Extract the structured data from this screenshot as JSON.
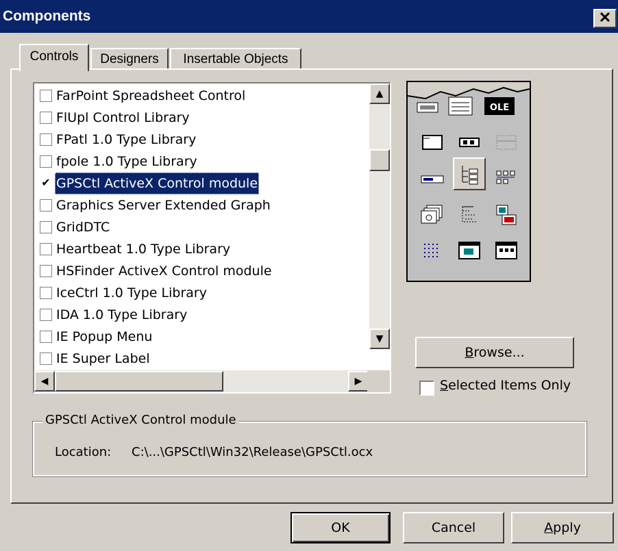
{
  "window": {
    "title": "Components",
    "close_glyph": "✕"
  },
  "tabs": [
    {
      "label": "Controls",
      "active": true
    },
    {
      "label": "Designers",
      "active": false
    },
    {
      "label": "Insertable Objects",
      "active": false
    }
  ],
  "list": {
    "items": [
      {
        "label": "FarPoint Spreadsheet Control",
        "checked": false,
        "selected": false
      },
      {
        "label": "FlUpl Control Library",
        "checked": false,
        "selected": false
      },
      {
        "label": "FPatl 1.0 Type Library",
        "checked": false,
        "selected": false
      },
      {
        "label": "fpole 1.0 Type Library",
        "checked": false,
        "selected": false
      },
      {
        "label": "GPSCtl ActiveX Control module",
        "checked": true,
        "selected": true
      },
      {
        "label": "Graphics Server Extended Graph",
        "checked": false,
        "selected": false
      },
      {
        "label": "GridDTC",
        "checked": false,
        "selected": false
      },
      {
        "label": "Heartbeat 1.0 Type Library",
        "checked": false,
        "selected": false
      },
      {
        "label": "HSFinder ActiveX Control module",
        "checked": false,
        "selected": false
      },
      {
        "label": "IceCtrl 1.0 Type Library",
        "checked": false,
        "selected": false
      },
      {
        "label": "IDA 1.0 Type Library",
        "checked": false,
        "selected": false
      },
      {
        "label": "IE Popup Menu",
        "checked": false,
        "selected": false
      },
      {
        "label": "IE Super Label",
        "checked": false,
        "selected": false
      }
    ],
    "check_glyph": "✔"
  },
  "toolbox": {
    "ole_label": "OLE",
    "icons": [
      "frame-icon",
      "label-control-icon",
      "dotted-frame-icon",
      "progress-bar-icon",
      "treeview-icon",
      "listview-icon",
      "tabstrip-icon",
      "outline-icon",
      "image-combo-icon",
      "dot-grid-icon",
      "animation-icon",
      "monthview-icon"
    ]
  },
  "buttons": {
    "browse": {
      "pre": "",
      "accel": "B",
      "post": "rowse..."
    },
    "ok": "OK",
    "cancel": "Cancel",
    "apply": {
      "accel": "A",
      "post": "pply"
    }
  },
  "selected_only": {
    "accel": "S",
    "post": "elected Items Only",
    "checked": false
  },
  "details": {
    "group_title": "GPSCtl ActiveX Control module",
    "location_label": "Location:",
    "location_value": "C:\\...\\GPSCtl\\Win32\\Release\\GPSCtl.ocx"
  },
  "scroll_glyphs": {
    "up": "▲",
    "down": "▼",
    "left": "◀",
    "right": "▶"
  }
}
